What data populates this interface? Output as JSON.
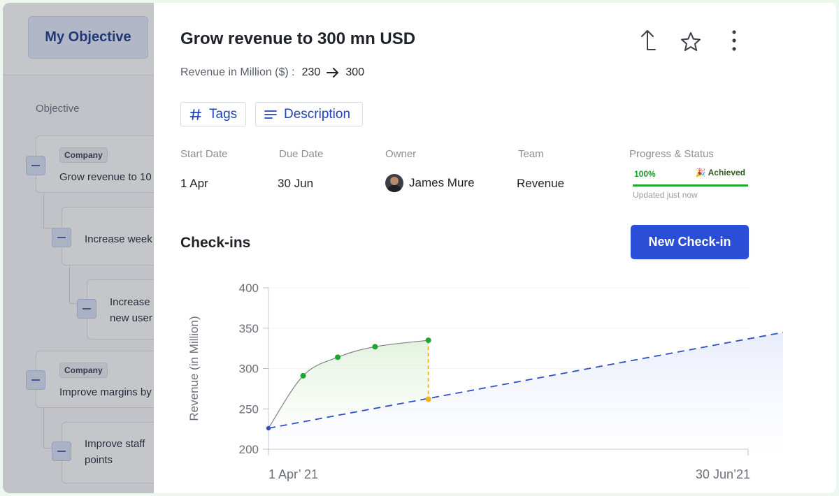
{
  "background_app": {
    "nav_button": "My Objective",
    "section_label": "Objective",
    "tree": [
      {
        "badge": "Company",
        "text": "Grow revenue to 10"
      },
      {
        "text": "Increase week"
      },
      {
        "text_lines": [
          "Increase",
          "new user"
        ]
      },
      {
        "badge": "Company",
        "text": "Improve margins by"
      },
      {
        "text_lines": [
          "Improve staff",
          "points"
        ]
      }
    ]
  },
  "objective": {
    "title": "Grow revenue to 300 mn USD",
    "metric_label": "Revenue in Million ($) :",
    "start_value": "230",
    "target_value": "300"
  },
  "chips": {
    "tags": "Tags",
    "description": "Description"
  },
  "meta": {
    "headers": {
      "start_date": "Start Date",
      "due_date": "Due Date",
      "owner": "Owner",
      "team": "Team",
      "progress": "Progress & Status"
    },
    "values": {
      "start_date": "1 Apr",
      "due_date": "30 Jun",
      "owner": "James Mure",
      "team": "Revenue",
      "progress_pct": "100%",
      "status": "Achieved",
      "updated": "Updated just now"
    },
    "progress_fraction": 1.0
  },
  "checkins": {
    "title": "Check-ins",
    "new_button": "New Check-in"
  },
  "colors": {
    "accent": "#2a4fd6",
    "success": "#1faa33",
    "target_line": "#2d4fc9",
    "gap_line": "#f2b01e"
  },
  "icons": {
    "share": "share-up-icon",
    "star": "star-icon",
    "more": "kebab-menu-icon",
    "arrow": "arrow-right-icon",
    "hash": "hash-icon",
    "description": "lines-icon"
  },
  "chart_data": {
    "type": "line",
    "ylabel": "Revenue (in Million)",
    "ylim": [
      200,
      400
    ],
    "yticks": [
      400,
      350,
      300,
      250,
      200
    ],
    "x_start_label": "1 Apr’ 21",
    "x_end_label": "30 Jun’21",
    "x_range": [
      0,
      90
    ],
    "series": [
      {
        "kind": "actual",
        "points": [
          [
            0,
            226
          ],
          [
            6.5,
            291
          ],
          [
            13,
            314
          ],
          [
            20,
            327
          ],
          [
            30,
            335
          ]
        ]
      },
      {
        "kind": "target",
        "points": [
          [
            0,
            226
          ],
          [
            100,
            349
          ]
        ]
      }
    ],
    "gap_marker": {
      "x": 30,
      "actual": 335,
      "target": 262
    }
  }
}
